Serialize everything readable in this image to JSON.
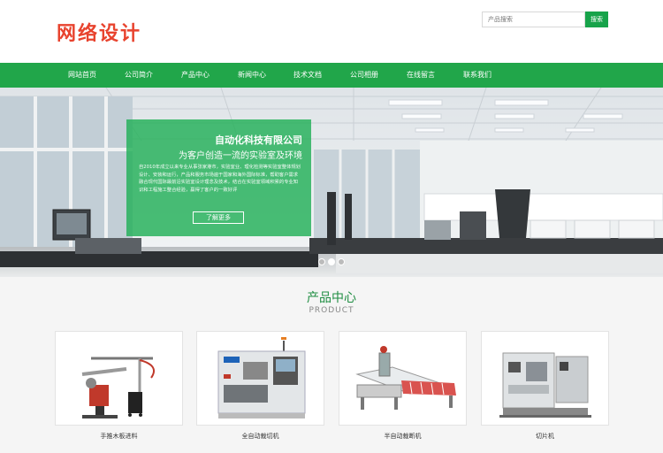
{
  "header": {
    "logo_text": "网络设计",
    "search_placeholder": "产品搜索",
    "search_button": "搜索"
  },
  "nav": {
    "items": [
      "网站首页",
      "公司简介",
      "产品中心",
      "新闻中心",
      "技术文档",
      "公司相册",
      "在线留言",
      "联系我们"
    ]
  },
  "banner": {
    "title": "自动化科技有限公司",
    "subtitle": "为客户创造一流的实验室及环境",
    "body": "自2010年成立以来专业从事张家港市，实验室业、理化检测等实验室整体规划设计、安装和运行，产品和服务市场遍于国家和海外国际标准，帮助客户需求融合现代国际最前沿实验室设计理念及技术，结合在实验室领域积累的专业知识和工程施工整合经验，赢得了客户的一致好评",
    "button": "了解更多",
    "slides": 3,
    "active_slide": 2
  },
  "products": {
    "title": "产品中心",
    "subtitle": "PRODUCT",
    "items": [
      {
        "label": "手推木板进料",
        "icon": "glass-edging-machine-image"
      },
      {
        "label": "全自动裁切机",
        "icon": "cnc-lathe-image"
      },
      {
        "label": "半自动裁断机",
        "icon": "glass-cutting-table-image"
      },
      {
        "label": "切片机",
        "icon": "slicing-machine-image"
      }
    ]
  },
  "colors": {
    "brand_green": "#21a64a",
    "logo_red": "#e8432e",
    "title_green": "#1e8d41"
  }
}
